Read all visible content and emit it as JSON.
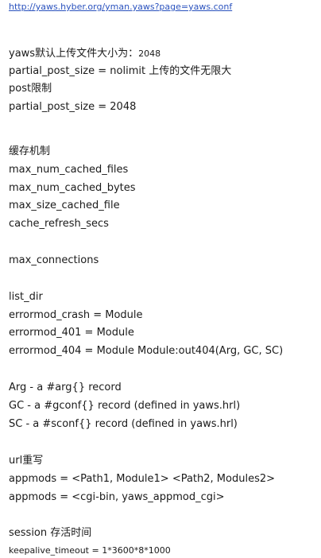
{
  "doc": {
    "link": "http://yaws.hyber.org/yman.yaws?page=yaws.conf",
    "upload_default_label": "yaws默认上传文件大小为：",
    "upload_default_value": "2048",
    "post_size_nolimit": "partial_post_size = nolimit 上传的文件无限大",
    "post_limit": "post限制",
    "post_size_2048": "partial_post_size = 2048",
    "cache_heading": "缓存机制",
    "cache_items": [
      "max_num_cached_files",
      "max_num_cached_bytes",
      "max_size_cached_file",
      "cache_refresh_secs"
    ],
    "max_connections": "max_connections",
    "list_dir": "list_dir",
    "errormod_crash": "errormod_crash = Module",
    "errormod_401": "errormod_401 = Module",
    "errormod_404": "errormod_404 = Module Module:out404(Arg, GC, SC)",
    "arg_desc": "Arg - a #arg{} record",
    "gc_desc": "GC - a #gconf{} record (defined in yaws.hrl)",
    "sc_desc": "SC - a #sconf{} record (defined in yaws.hrl)",
    "url_rewrite": "url重写",
    "appmods_1": "appmods = <Path1, Module1> <Path2, Modules2>",
    "appmods_2": "appmods = <cgi-bin, yaws_appmod_cgi>",
    "session_label": "session 存活时间",
    "keepalive": "keepalive_timeout = 1*3600*8*1000"
  }
}
